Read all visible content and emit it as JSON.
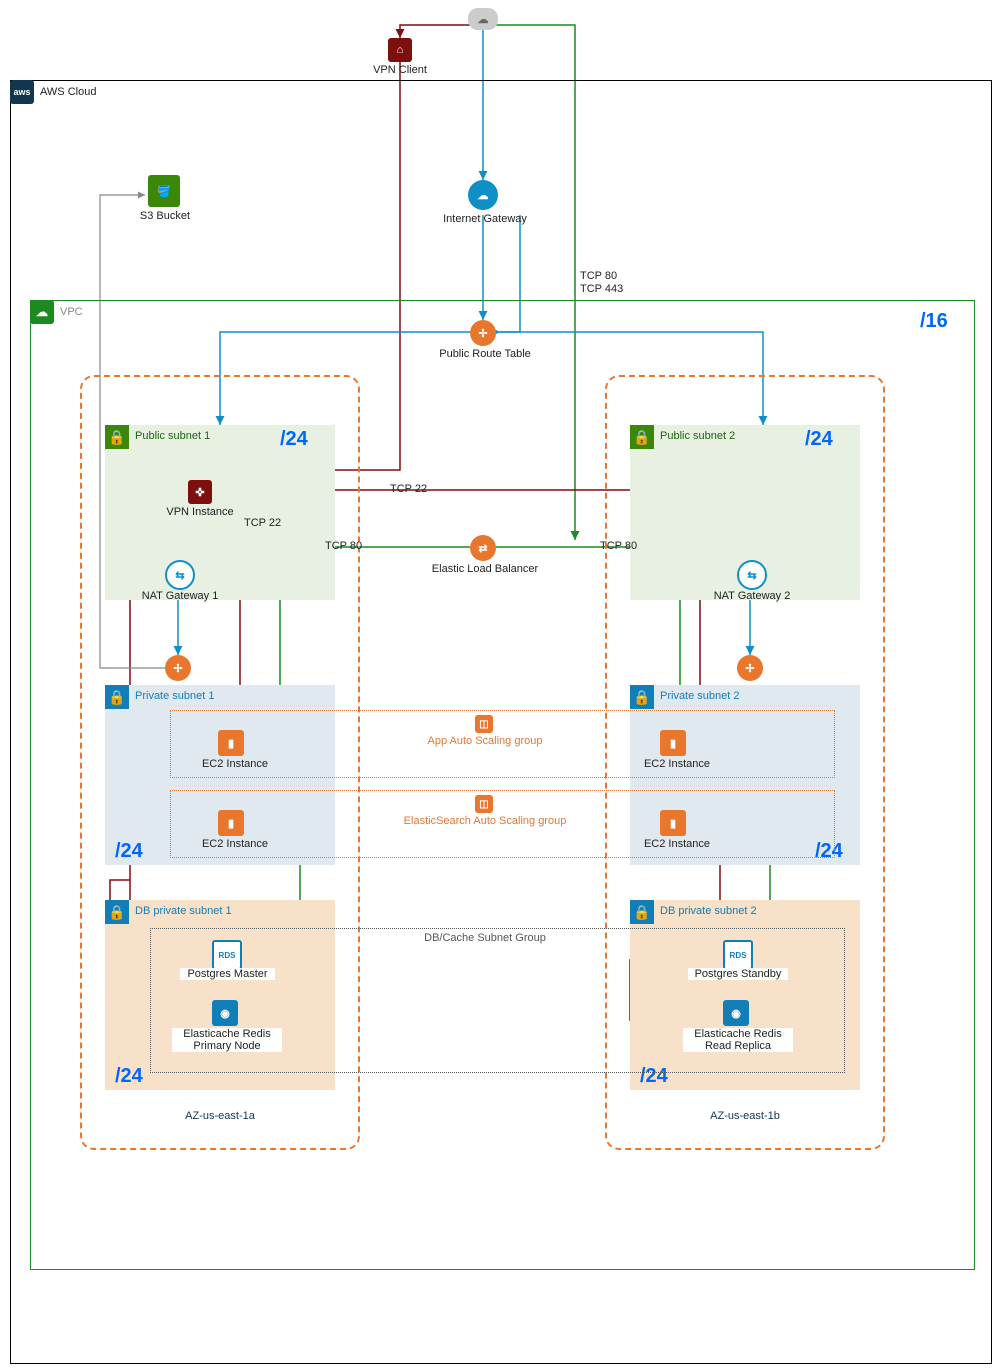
{
  "top": {
    "cloud": "☁",
    "vpn_client": "VPN Client"
  },
  "aws": {
    "label": "AWS Cloud",
    "s3": "S3 Bucket",
    "igw": "Internet Gateway"
  },
  "vpc": {
    "label": "VPC",
    "cidr": "/16",
    "route_table": "Public Route Table",
    "elb": "Elastic Load Balancer",
    "asg_app": "App Auto Scaling group",
    "asg_es": "ElasticSearch Auto Scaling group",
    "subnet_group": "DB/Cache Subnet Group"
  },
  "ports": {
    "igw1": "TCP 80",
    "igw2": "TCP 443",
    "ssh1": "TCP 22",
    "ssh2": "TCP 22",
    "http1": "TCP 80",
    "http2": "TCP 80"
  },
  "az1": {
    "name": "AZ-us-east-1a",
    "public": {
      "name": "Public subnet 1",
      "cidr": "/24"
    },
    "private": {
      "name": "Private subnet 1",
      "cidr": "/24"
    },
    "db": {
      "name": "DB private subnet 1",
      "cidr": "/24"
    },
    "vpn": "VPN Instance",
    "nat": "NAT Gateway 1",
    "ec2a": "EC2 Instance",
    "ec2b": "EC2 Instance",
    "rds": "Postgres Master",
    "redis": "Elasticache Redis",
    "redis2": "Primary Node"
  },
  "az2": {
    "name": "AZ-us-east-1b",
    "public": {
      "name": "Public subnet 2",
      "cidr": "/24"
    },
    "private": {
      "name": "Private subnet 2",
      "cidr": "/24"
    },
    "db": {
      "name": "DB private subnet 2",
      "cidr": "/24"
    },
    "nat": "NAT Gateway 2",
    "ec2a": "EC2 Instance",
    "ec2b": "EC2 Instance",
    "rds": "Postgres Standby",
    "redis": "Elasticache Redis",
    "redis2": "Read Replica"
  },
  "colors": {
    "green": "#1b660f",
    "orange": "#e8762d",
    "blue": "#117eb8",
    "navy": "#13364f",
    "maroon": "#7d0f0f",
    "teal": "#0e8fc7",
    "s3": "#3b8708",
    "vpc_border": "#1b8a1f",
    "pub_fill": "#e8f0e1",
    "priv_fill": "#e1e9f0",
    "db_fill": "#f7e1c8",
    "pub_hdr": "#3b8708",
    "priv_hdr": "#117eb8",
    "db_hdr": "#e8762d"
  }
}
